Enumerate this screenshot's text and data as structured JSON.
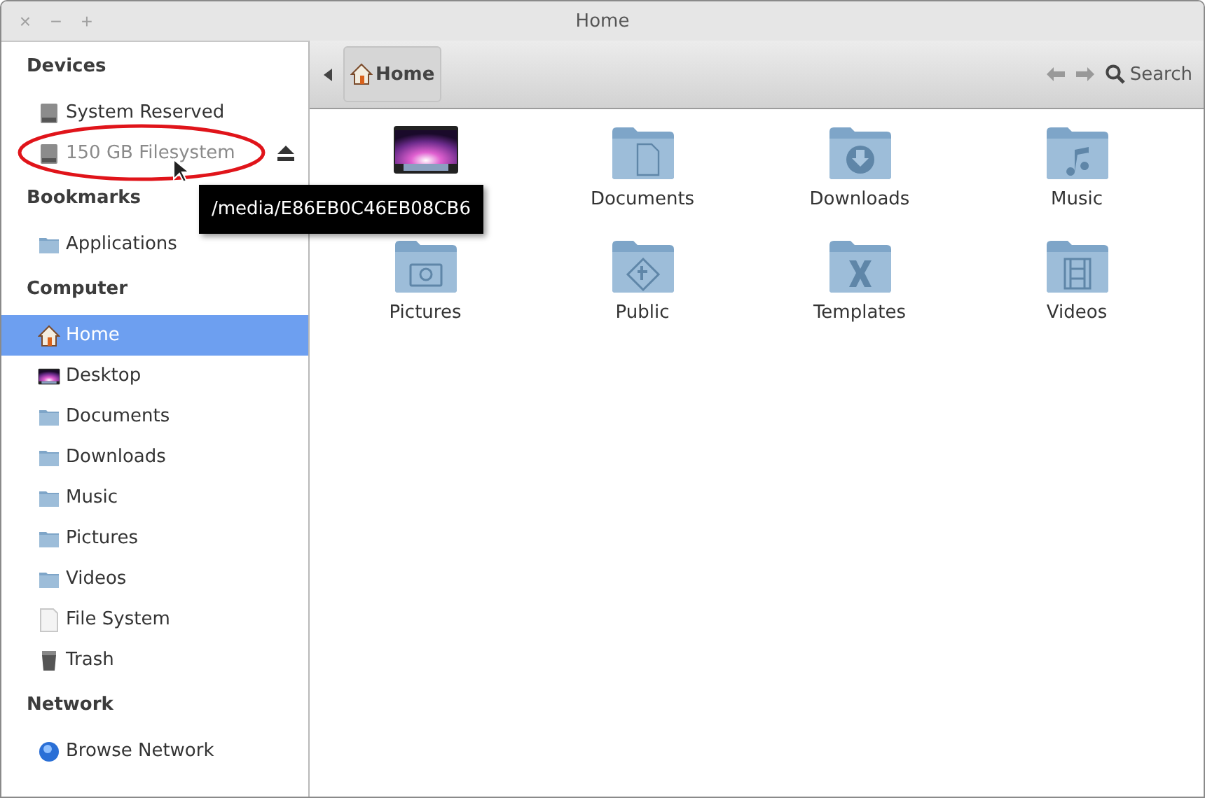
{
  "window": {
    "title": "Home",
    "controls": [
      "×",
      "−",
      "+"
    ]
  },
  "sidebar": {
    "sections": [
      {
        "heading": "Devices",
        "items": [
          {
            "kind": "drive",
            "label": "System Reserved",
            "selected": false,
            "mounted": true,
            "eject": false
          },
          {
            "kind": "drive",
            "label": "150 GB Filesystem",
            "selected": false,
            "mounted": false,
            "eject": true
          }
        ]
      },
      {
        "heading": "Bookmarks",
        "items": [
          {
            "kind": "folder",
            "label": "Applications",
            "selected": false,
            "mounted": true,
            "eject": false
          }
        ]
      },
      {
        "heading": "Computer",
        "items": [
          {
            "kind": "home",
            "label": "Home",
            "selected": true,
            "mounted": true,
            "eject": false
          },
          {
            "kind": "desktop",
            "label": "Desktop",
            "selected": false,
            "mounted": true,
            "eject": false
          },
          {
            "kind": "folder",
            "label": "Documents",
            "selected": false,
            "mounted": true,
            "eject": false
          },
          {
            "kind": "folder",
            "label": "Downloads",
            "selected": false,
            "mounted": true,
            "eject": false
          },
          {
            "kind": "folder",
            "label": "Music",
            "selected": false,
            "mounted": true,
            "eject": false
          },
          {
            "kind": "folder",
            "label": "Pictures",
            "selected": false,
            "mounted": true,
            "eject": false
          },
          {
            "kind": "folder",
            "label": "Videos",
            "selected": false,
            "mounted": true,
            "eject": false
          },
          {
            "kind": "file",
            "label": "File System",
            "selected": false,
            "mounted": true,
            "eject": false
          },
          {
            "kind": "trash",
            "label": "Trash",
            "selected": false,
            "mounted": true,
            "eject": false
          }
        ]
      },
      {
        "heading": "Network",
        "items": [
          {
            "kind": "network",
            "label": "Browse Network",
            "selected": false,
            "mounted": true,
            "eject": false
          }
        ]
      }
    ]
  },
  "toolbar": {
    "path": "Home",
    "search": "Search"
  },
  "files": [
    {
      "kind": "desktop"
    },
    {
      "kind": "documents",
      "label": "Documents"
    },
    {
      "kind": "downloads",
      "label": "Downloads"
    },
    {
      "kind": "music",
      "label": "Music"
    },
    {
      "kind": "pictures",
      "label": "Pictures"
    },
    {
      "kind": "public",
      "label": "Public"
    },
    {
      "kind": "templates",
      "label": "Templates"
    },
    {
      "kind": "videos",
      "label": "Videos"
    }
  ],
  "tooltip": "/media/E86EB0C46EB08CB6"
}
